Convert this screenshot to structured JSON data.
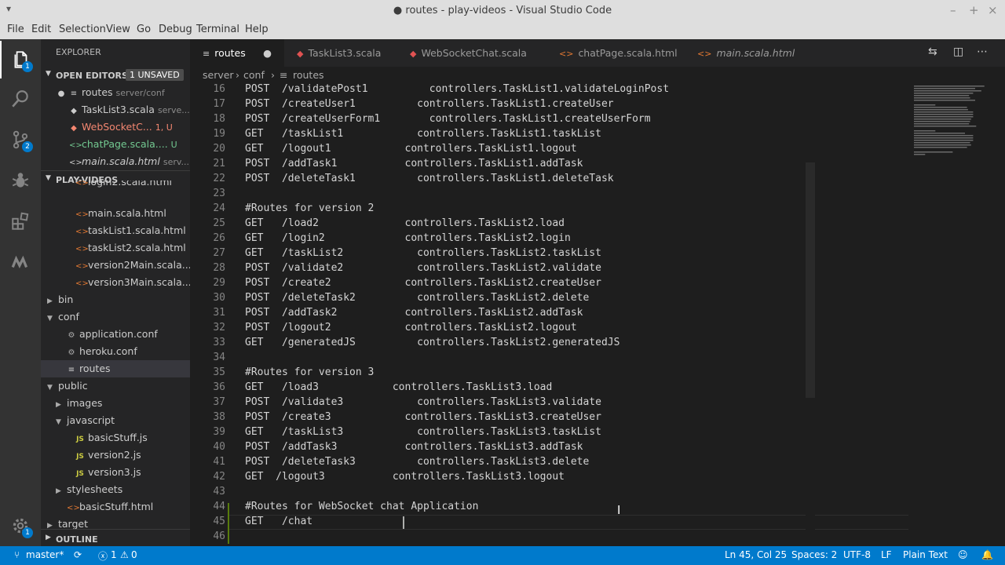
{
  "window": {
    "title": "● routes - play-videos - Visual Studio Code"
  },
  "menu": [
    "File",
    "Edit",
    "Selection",
    "View",
    "Go",
    "Debug",
    "Terminal",
    "Help"
  ],
  "activity": {
    "explorer_badge": "1",
    "scm_badge": "2",
    "settings_badge": "1"
  },
  "sidebar": {
    "explorer_title": "EXPLORER",
    "open_editors": {
      "title": "OPEN EDITORS",
      "badge": "1 UNSAVED",
      "items": [
        {
          "name": "routes",
          "path": "server/conf",
          "icon": "≡",
          "color": "#cccccc",
          "dirty": true
        },
        {
          "name": "TaskList3.scala",
          "path": "serve...",
          "icon": "◆",
          "color": "#cccccc",
          "dirty": false
        },
        {
          "name": "WebSocketC...",
          "path": "1, U",
          "icon": "◆",
          "color": "#f48771",
          "dirty": false
        },
        {
          "name": "chatPage.scala....",
          "path": "U",
          "icon": "<>",
          "color": "#73c991",
          "dirty": false
        },
        {
          "name": "main.scala.html",
          "path": "serv...",
          "icon": "<>",
          "color": "#cccccc",
          "dirty": false
        }
      ]
    },
    "project": {
      "title": "PLAY-VIDEOS",
      "items": [
        {
          "label": "login2.scala.html",
          "type": "html",
          "depth": 2,
          "partial": true
        },
        {
          "label": "main.scala.html",
          "type": "html",
          "depth": 2
        },
        {
          "label": "taskList1.scala.html",
          "type": "html",
          "depth": 2
        },
        {
          "label": "taskList2.scala.html",
          "type": "html",
          "depth": 2
        },
        {
          "label": "version2Main.scala....",
          "type": "html",
          "depth": 2
        },
        {
          "label": "version3Main.scala....",
          "type": "html",
          "depth": 2
        },
        {
          "label": "bin",
          "type": "folder-closed",
          "depth": 0
        },
        {
          "label": "conf",
          "type": "folder-open",
          "depth": 0
        },
        {
          "label": "application.conf",
          "type": "gear",
          "depth": 1
        },
        {
          "label": "heroku.conf",
          "type": "gear",
          "depth": 1
        },
        {
          "label": "routes",
          "type": "lines",
          "depth": 1,
          "selected": true
        },
        {
          "label": "public",
          "type": "folder-open",
          "depth": 0
        },
        {
          "label": "images",
          "type": "folder-closed",
          "depth": 1
        },
        {
          "label": "javascript",
          "type": "folder-open",
          "depth": 1
        },
        {
          "label": "basicStuff.js",
          "type": "js",
          "depth": 2
        },
        {
          "label": "version2.js",
          "type": "js",
          "depth": 2
        },
        {
          "label": "version3.js",
          "type": "js",
          "depth": 2
        },
        {
          "label": "stylesheets",
          "type": "folder-closed",
          "depth": 1
        },
        {
          "label": "basicStuff.html",
          "type": "html",
          "depth": 1
        },
        {
          "label": "target",
          "type": "folder-closed",
          "depth": 0
        }
      ]
    },
    "outline_title": "OUTLINE"
  },
  "tabs": [
    {
      "label": "routes",
      "icon": "≡",
      "active": true,
      "dirty": true,
      "italic": false,
      "color": "#cccccc"
    },
    {
      "label": "TaskList3.scala",
      "icon": "◆",
      "active": false,
      "dirty": false,
      "italic": false,
      "color": "#e05252"
    },
    {
      "label": "WebSocketChat.scala",
      "icon": "◆",
      "active": false,
      "dirty": false,
      "italic": false,
      "color": "#e05252"
    },
    {
      "label": "chatPage.scala.html",
      "icon": "<>",
      "active": false,
      "dirty": false,
      "italic": false,
      "color": "#e37933"
    },
    {
      "label": "main.scala.html",
      "icon": "<>",
      "active": false,
      "dirty": false,
      "italic": true,
      "color": "#e37933"
    }
  ],
  "breadcrumb": [
    "server",
    "conf",
    "routes"
  ],
  "editor": {
    "lines": [
      {
        "n": "16",
        "t": "POST  /validatePost1          controllers.TaskList1.validateLoginPost"
      },
      {
        "n": "17",
        "t": "POST  /createUser1          controllers.TaskList1.createUser"
      },
      {
        "n": "18",
        "t": "POST  /createUserForm1        controllers.TaskList1.createUserForm"
      },
      {
        "n": "19",
        "t": "GET   /taskList1            controllers.TaskList1.taskList"
      },
      {
        "n": "20",
        "t": "GET   /logout1            controllers.TaskList1.logout"
      },
      {
        "n": "21",
        "t": "POST  /addTask1           controllers.TaskList1.addTask"
      },
      {
        "n": "22",
        "t": "POST  /deleteTask1          controllers.TaskList1.deleteTask"
      },
      {
        "n": "23",
        "t": ""
      },
      {
        "n": "24",
        "t": "#Routes for version 2"
      },
      {
        "n": "25",
        "t": "GET   /load2              controllers.TaskList2.load"
      },
      {
        "n": "26",
        "t": "GET   /login2             controllers.TaskList2.login"
      },
      {
        "n": "27",
        "t": "GET   /taskList2            controllers.TaskList2.taskList"
      },
      {
        "n": "28",
        "t": "POST  /validate2            controllers.TaskList2.validate"
      },
      {
        "n": "29",
        "t": "POST  /create2            controllers.TaskList2.createUser"
      },
      {
        "n": "30",
        "t": "POST  /deleteTask2          controllers.TaskList2.delete"
      },
      {
        "n": "31",
        "t": "POST  /addTask2           controllers.TaskList2.addTask"
      },
      {
        "n": "32",
        "t": "POST  /logout2            controllers.TaskList2.logout"
      },
      {
        "n": "33",
        "t": "GET   /generatedJS          controllers.TaskList2.generatedJS"
      },
      {
        "n": "34",
        "t": ""
      },
      {
        "n": "35",
        "t": "#Routes for version 3"
      },
      {
        "n": "36",
        "t": "GET   /load3            controllers.TaskList3.load"
      },
      {
        "n": "37",
        "t": "POST  /validate3            controllers.TaskList3.validate"
      },
      {
        "n": "38",
        "t": "POST  /create3            controllers.TaskList3.createUser"
      },
      {
        "n": "39",
        "t": "GET   /taskList3            controllers.TaskList3.taskList"
      },
      {
        "n": "40",
        "t": "POST  /addTask3           controllers.TaskList3.addTask"
      },
      {
        "n": "41",
        "t": "POST  /deleteTask3          controllers.TaskList3.delete"
      },
      {
        "n": "42",
        "t": "GET  /logout3           controllers.TaskList3.logout"
      },
      {
        "n": "43",
        "t": ""
      },
      {
        "n": "44",
        "t": "#Routes for WebSocket chat Application"
      },
      {
        "n": "45",
        "t": "GET   /chat"
      },
      {
        "n": "46",
        "t": ""
      }
    ]
  },
  "status": {
    "branch": "master*",
    "sync": "⟳",
    "errors": "1",
    "warnings": "0",
    "position": "Ln 45, Col 25",
    "spaces": "Spaces: 2",
    "encoding": "UTF-8",
    "eol": "LF",
    "language": "Plain Text"
  }
}
